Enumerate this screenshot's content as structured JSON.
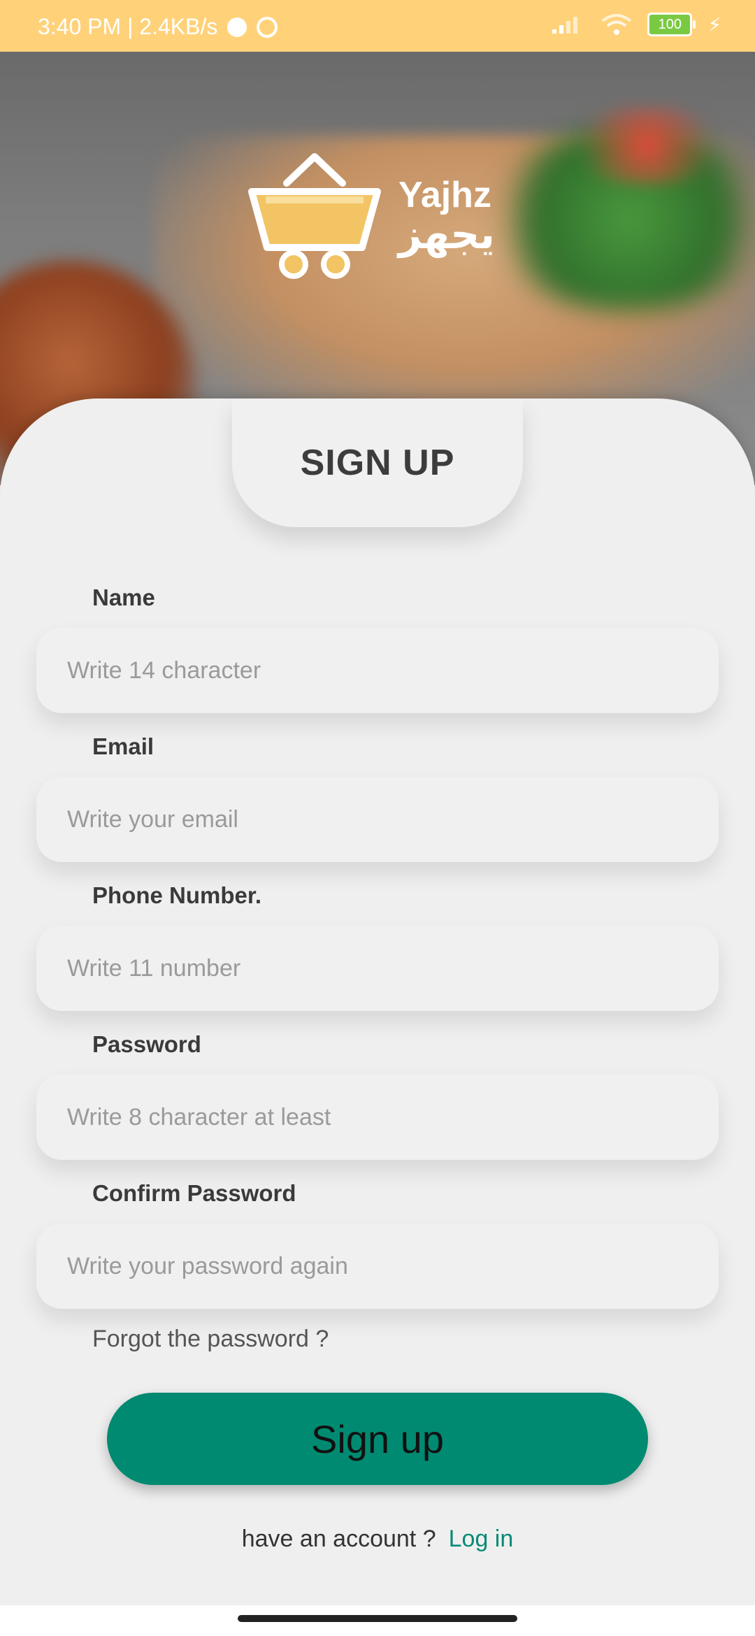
{
  "status_bar": {
    "time_speed": "3:40 PM | 2.4KB/s",
    "battery": "100"
  },
  "brand": {
    "name_en": "Yajhz",
    "name_ar": "يجهز"
  },
  "page": {
    "title": "SIGN UP"
  },
  "form": {
    "name_label": "Name",
    "name_placeholder": "Write 14 character",
    "email_label": "Email",
    "email_placeholder": "Write your email",
    "phone_label": "Phone Number.",
    "phone_placeholder": "Write 11 number",
    "password_label": "Password",
    "password_placeholder": "Write 8 character at least",
    "confirm_label": "Confirm Password",
    "confirm_placeholder": "Write your password again",
    "forgot_text": "Forgot the password ?",
    "signup_button": "Sign up",
    "have_account_text": "have an account ?",
    "login_link": "Log in"
  },
  "colors": {
    "status_bar_bg": "#ffd27a",
    "primary_button": "#008a71",
    "link": "#078a76"
  }
}
